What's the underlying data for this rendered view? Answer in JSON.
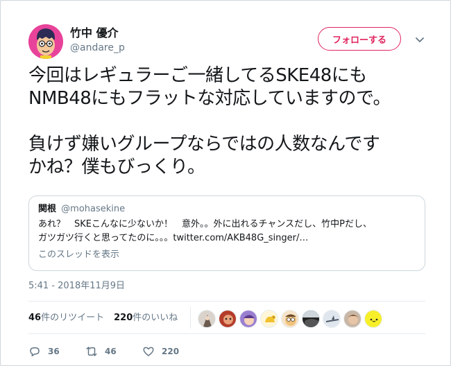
{
  "author": {
    "display_name": "竹中 優介",
    "handle": "@andare_p",
    "avatar_icon": "cartoon-face-avatar"
  },
  "follow_button": {
    "label": "フォローする",
    "color": "#e0245e"
  },
  "tweet": {
    "lines": [
      "今回はレギュラーご一緒してるSKE48にも",
      "NMB48にもフラットな対応していますので。",
      "負けず嫌いグループならではの人数なんです",
      "かね？僕もびっくり。"
    ]
  },
  "quoted_tweet": {
    "name": "関根",
    "handle": "@mohasekine",
    "line1": "あれ？　SKEこんなに少ないか！　意外。。外に出れるチャンスだし、竹中Pだし、",
    "line2": "ガツガツ行くと思ってたのに。。。twitter.com/AKB48G_singer/…",
    "thread_link": "このスレッドを表示"
  },
  "timestamp": "5:41 - 2018年11月9日",
  "stats": {
    "retweets_count": "46",
    "retweets_label": "件のリツイート",
    "likes_count": "220",
    "likes_label": "件のいいね"
  },
  "likers": [
    {
      "icon": "liker-avatar-1"
    },
    {
      "icon": "liker-avatar-2"
    },
    {
      "icon": "liker-avatar-3"
    },
    {
      "icon": "liker-avatar-4"
    },
    {
      "icon": "liker-avatar-5"
    },
    {
      "icon": "liker-avatar-6"
    },
    {
      "icon": "liker-avatar-7"
    },
    {
      "icon": "liker-avatar-8"
    },
    {
      "icon": "liker-avatar-9"
    }
  ],
  "actions": {
    "reply_count": "36",
    "retweet_count": "46",
    "like_count": "220"
  },
  "colors": {
    "accent": "#e0245e",
    "muted": "#657786",
    "text": "#14171a",
    "border": "#ccd6dd"
  }
}
